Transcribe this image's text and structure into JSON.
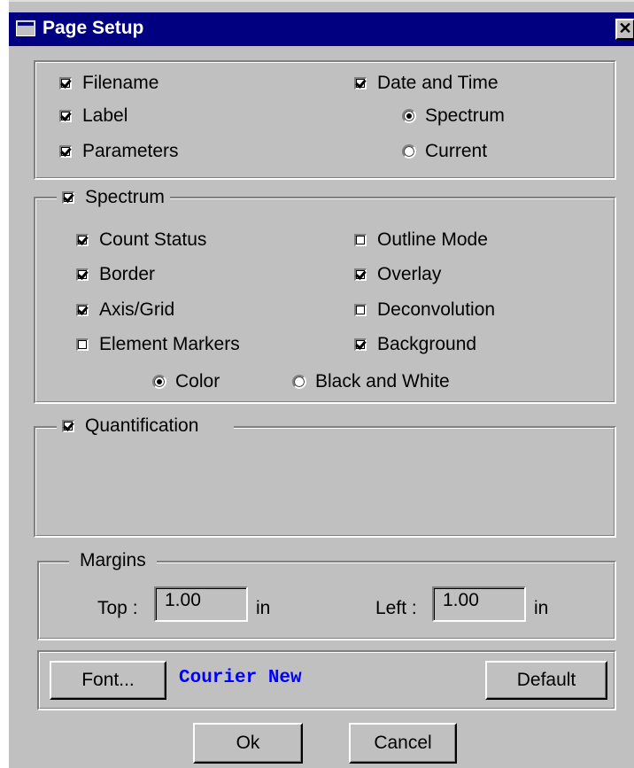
{
  "window": {
    "title": "Page Setup",
    "close_glyph": "✕",
    "title_icon": "window-icon"
  },
  "header_group": {
    "filename": {
      "label": "Filename",
      "checked": true
    },
    "label": {
      "label": "Label",
      "checked": true
    },
    "parameters": {
      "label": "Parameters",
      "checked": true
    },
    "date_time": {
      "label": "Date and Time",
      "checked": true
    },
    "date_source": {
      "options": [
        {
          "label": "Spectrum",
          "selected": true
        },
        {
          "label": "Current",
          "selected": false
        }
      ]
    }
  },
  "spectrum_group": {
    "title": {
      "label": "Spectrum",
      "checked": true
    },
    "left": [
      {
        "label": "Count Status",
        "checked": true
      },
      {
        "label": "Border",
        "checked": true
      },
      {
        "label": "Axis/Grid",
        "checked": true
      },
      {
        "label": "Element Markers",
        "checked": false
      }
    ],
    "right": [
      {
        "label": "Outline Mode",
        "checked": false
      },
      {
        "label": "Overlay",
        "checked": true
      },
      {
        "label": "Deconvolution",
        "checked": false
      },
      {
        "label": "Background",
        "checked": true
      }
    ],
    "color_mode": [
      {
        "label": "Color",
        "selected": true
      },
      {
        "label": "Black and White",
        "selected": false
      }
    ]
  },
  "quantification_group": {
    "title": {
      "label": "Quantification",
      "checked": true
    }
  },
  "margins_group": {
    "title": "Margins",
    "top_label": "Top :",
    "top_value": "1.00",
    "top_unit": "in",
    "left_label": "Left :",
    "left_value": "1.00",
    "left_unit": "in"
  },
  "font_group": {
    "font_button": "Font...",
    "font_name": "Courier New",
    "default_button": "Default"
  },
  "footer": {
    "ok_button": "Ok",
    "cancel_button": "Cancel"
  },
  "colors": {
    "titlebar": "#000080",
    "face": "#c0c0c0",
    "font_name": "#0000ff"
  }
}
